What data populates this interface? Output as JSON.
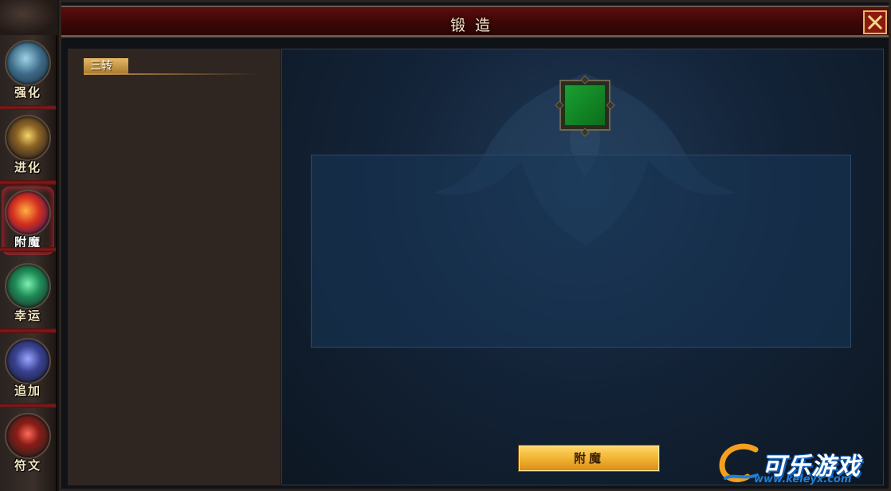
{
  "window": {
    "title": "锻造"
  },
  "tabs": [
    {
      "label": "强化",
      "icon": "cube-icon",
      "active": false
    },
    {
      "label": "进化",
      "icon": "orb-icon",
      "active": false
    },
    {
      "label": "附魔",
      "icon": "enchant-icon",
      "active": true
    },
    {
      "label": "幸运",
      "icon": "gem-icon",
      "active": false
    },
    {
      "label": "追加",
      "icon": "armor-icon",
      "active": false
    },
    {
      "label": "符文",
      "icon": "rune-icon",
      "active": false
    }
  ],
  "list": {
    "items": [
      {
        "label": "三转"
      }
    ]
  },
  "main": {
    "action_label": "附魔"
  },
  "watermark": {
    "brand": "可乐游戏",
    "url": "www.keleyx.com"
  },
  "colors": {
    "accent_gold": "#f2b432",
    "title_red": "#5c0e0e",
    "slot_green": "#1aa031"
  }
}
